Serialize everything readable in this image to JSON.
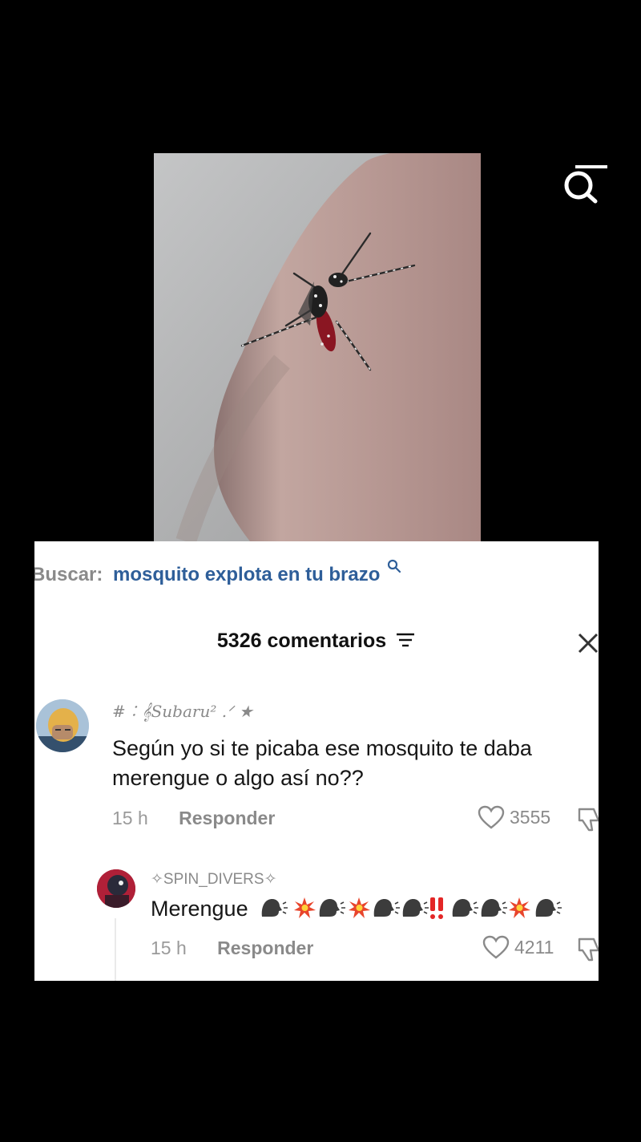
{
  "search": {
    "label": "Buscar:",
    "term": "mosquito explota en tu brazo"
  },
  "comments_header": {
    "count_label": "5326 comentarios"
  },
  "comments": [
    {
      "username": "#︰𝄞Subaru² .ᐟ ★",
      "text_line1": "Según yo si te picaba ese mosquito te daba",
      "text_line2": "merengue o algo así no??",
      "time": "15 h",
      "reply_label": "Responder",
      "likes": "3555"
    }
  ],
  "replies": [
    {
      "username": "✧SPIN_DIVERS✧",
      "text": "Merengue",
      "time": "15 h",
      "reply_label": "Responder",
      "likes": "4211"
    }
  ],
  "icons": [
    "search-icon",
    "filter-icon",
    "close-icon",
    "heart-icon",
    "dislike-icon",
    "speaking-head-icon",
    "collision-icon",
    "double-exclamation-icon"
  ],
  "colors": {
    "search_term": "#2e5e99",
    "muted_text": "#8a8a8a",
    "background": "#000000",
    "card": "#ffffff"
  }
}
